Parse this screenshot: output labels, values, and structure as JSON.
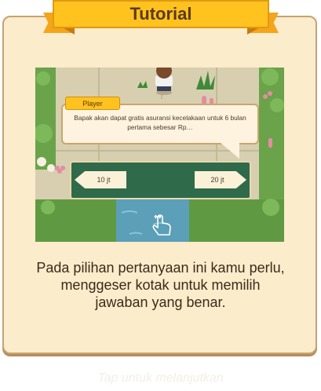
{
  "dialog": {
    "title": "Tutorial",
    "instructions_line1": "Pada pilihan pertanyaan ini kamu perlu,",
    "instructions_line2": "menggeser kotak untuk memilih",
    "instructions_line3": "jawaban yang benar."
  },
  "preview": {
    "speaker": "Player",
    "question_line1": "Bapak akan dapat gratis asuransi kecelakaan untuk 6 bulan",
    "question_line2": "pertama sebesar Rp…",
    "option_left": "10 jt",
    "option_right": "20 jt",
    "gesture_icon": "swipe-hand-icon"
  },
  "footer": {
    "tap_to_continue": "Tap untuk melanjutkan"
  },
  "colors": {
    "card_bg": "#fbeccb",
    "ribbon": "#ffc21e",
    "slider_bg": "#2f6a4a",
    "text": "#3c2a1a"
  }
}
